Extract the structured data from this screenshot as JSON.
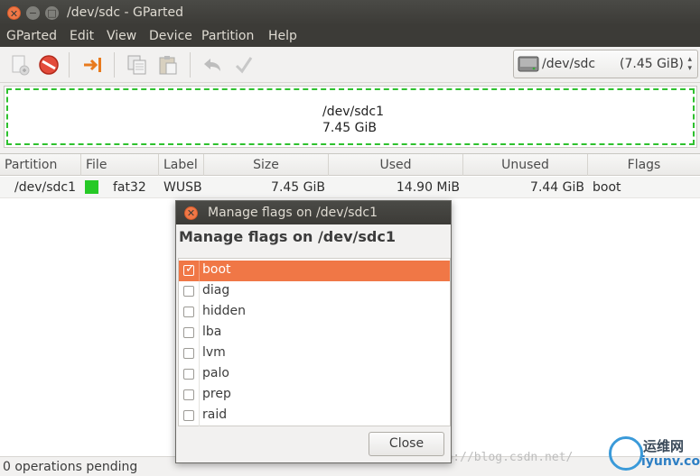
{
  "window": {
    "title": "/dev/sdc - GParted"
  },
  "menubar": {
    "items": [
      "GParted",
      "Edit",
      "View",
      "Device",
      "Partition",
      "Help"
    ]
  },
  "toolbar": {
    "icons": [
      "new-partition-icon",
      "delete-icon",
      "resize-move-icon",
      "copy-icon",
      "paste-icon",
      "undo-icon",
      "apply-icon"
    ]
  },
  "device_selector": {
    "device": "/dev/sdc",
    "size": "(7.45 GiB)"
  },
  "disk_map": {
    "partition": "/dev/sdc1",
    "size": "7.45 GiB",
    "fs_color": "#26c926"
  },
  "table": {
    "headers": [
      "Partition",
      "File System",
      "Label",
      "Size",
      "Used",
      "Unused",
      "Flags"
    ],
    "rows": [
      {
        "partition": "/dev/sdc1",
        "filesystem": "fat32",
        "label": "WUSB",
        "size": "7.45 GiB",
        "used": "14.90 MiB",
        "unused": "7.44 GiB",
        "flags": "boot"
      }
    ]
  },
  "status": {
    "text": "0 operations pending"
  },
  "dialog": {
    "title": "Manage flags on /dev/sdc1",
    "heading": "Manage flags on /dev/sdc1",
    "flags": [
      {
        "name": "boot",
        "checked": true,
        "selected": true
      },
      {
        "name": "diag",
        "checked": false
      },
      {
        "name": "hidden",
        "checked": false
      },
      {
        "name": "lba",
        "checked": false
      },
      {
        "name": "lvm",
        "checked": false
      },
      {
        "name": "palo",
        "checked": false
      },
      {
        "name": "prep",
        "checked": false
      },
      {
        "name": "raid",
        "checked": false
      }
    ],
    "close_label": "Close"
  },
  "watermark": {
    "url": "http://blog.csdn.net/",
    "brand_cn": "运维网",
    "brand_en": "iyunv.com"
  },
  "colors": {
    "accent": "#f07746",
    "titlebar": "#3c3b37",
    "fs_fat32": "#26c926"
  }
}
